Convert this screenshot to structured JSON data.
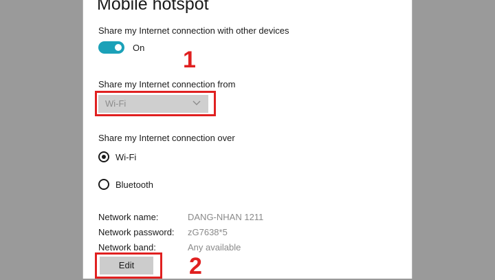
{
  "page": {
    "title": "Mobile hotspot"
  },
  "share_connection": {
    "label": "Share my Internet connection with other devices",
    "toggle_state": "On",
    "toggle_on": true,
    "toggle_color": "#1ba1b8"
  },
  "share_from": {
    "label": "Share my Internet connection from",
    "selected": "Wi-Fi",
    "chevron_icon": "chevron-down-icon"
  },
  "share_over": {
    "label": "Share my Internet connection over",
    "options": [
      {
        "label": "Wi-Fi",
        "selected": true
      },
      {
        "label": "Bluetooth",
        "selected": false
      }
    ]
  },
  "network": {
    "name_label": "Network name:",
    "name_value": "DANG-NHAN 1211",
    "password_label": "Network password:",
    "password_value": "zG7638*5",
    "band_label": "Network band:",
    "band_value": "Any available"
  },
  "edit_button": {
    "label": "Edit"
  },
  "annotations": {
    "step1": "1",
    "step2": "2",
    "color": "#e02020"
  }
}
